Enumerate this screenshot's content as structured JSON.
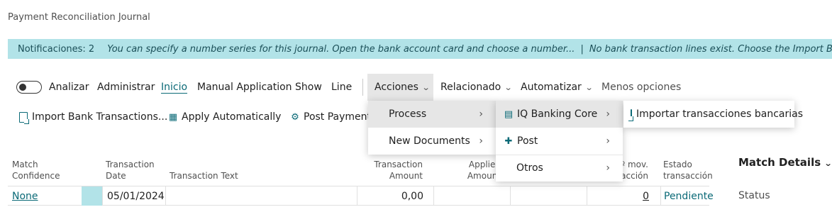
{
  "page": {
    "title": "Payment Reconciliation Journal"
  },
  "notifications": {
    "count_label": "Notificaciones: 2",
    "messages": [
      "You can specify a number series for this journal. Open the bank account card and choose a number...",
      "No bank transaction lines exist. Choose the Import Bank Transactio"
    ],
    "separator": "|",
    "color": "#b2e3e8"
  },
  "actionbar": {
    "analizar": "Analizar",
    "administrar": "Administrar",
    "inicio": "Inicio",
    "manual_application": "Manual Application",
    "show": "Show",
    "line": "Line",
    "acciones": "Acciones",
    "relacionado": "Relacionado",
    "automatizar": "Automatizar",
    "menos_opciones": "Menos opciones"
  },
  "sub_actions": {
    "import_bank": "Import Bank Transactions...",
    "apply_automatically": "Apply Automatically",
    "post_payments": "Post Payments"
  },
  "menus": {
    "acciones": [
      "Process",
      "New Documents"
    ],
    "process": [
      "IQ Banking Core",
      "Post",
      "Otros"
    ],
    "iq_banking_core": [
      "Importar transacciones bancarias"
    ]
  },
  "grid": {
    "headers": {
      "match_confidence": [
        "Match",
        "Confidence"
      ],
      "transaction_date": [
        "Transaction",
        "Date"
      ],
      "transaction_text": "Transaction Text",
      "transaction_amount": [
        "Transaction",
        "Amount"
      ],
      "applied_amount": [
        "Applied",
        "Amount"
      ],
      "mov_transaccion": [
        "º mov.",
        "acción"
      ],
      "estado_transaccion": [
        "Estado",
        "transacción"
      ]
    },
    "rows": [
      {
        "match_confidence": "None",
        "transaction_date": "05/01/2024",
        "transaction_text": "",
        "transaction_amount": "0,00",
        "applied_amount": "",
        "mov_transaccion": "0",
        "estado": "Pendiente"
      }
    ]
  },
  "side_panel": {
    "title": "Match Details",
    "status_label": "Status"
  },
  "colors": {
    "accent": "#0b6a77",
    "notification_bg": "#b2e3e8",
    "menu_hover": "#e6e6e6"
  }
}
